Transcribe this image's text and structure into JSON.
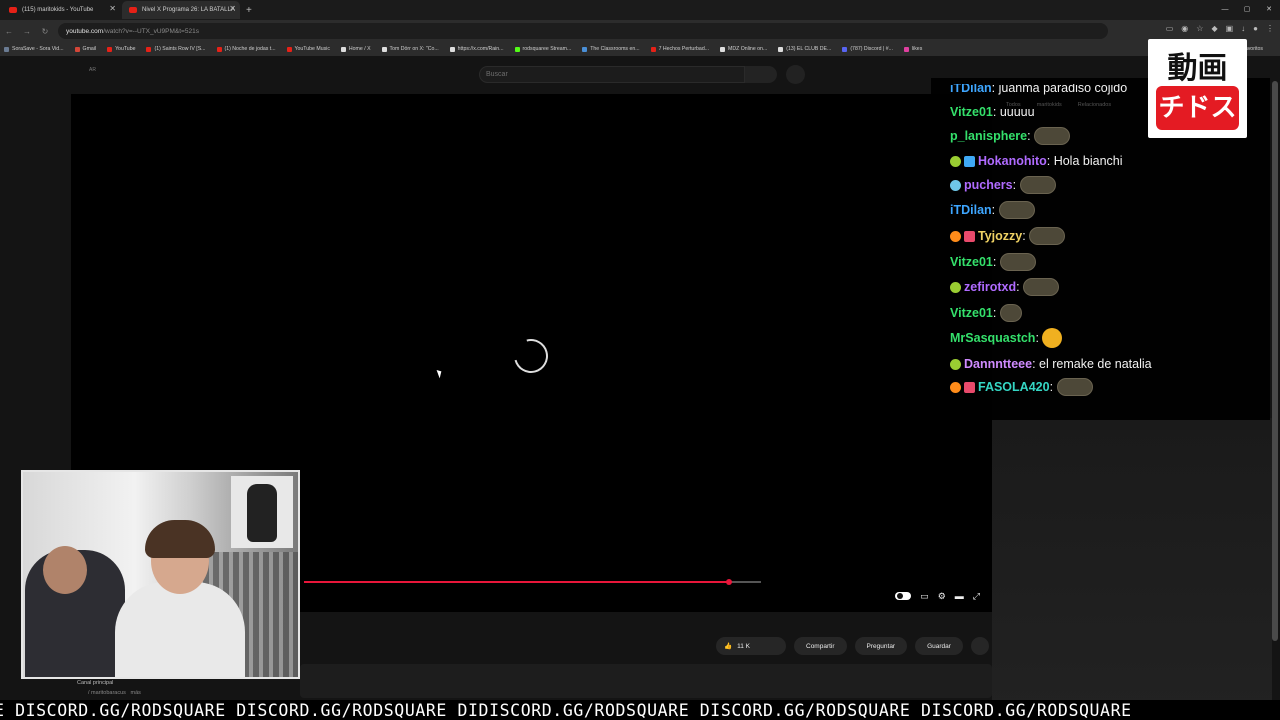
{
  "browser": {
    "tabs": [
      {
        "label": "(115) maritokids - YouTube",
        "active": false
      },
      {
        "label": "Nivel X Programa 26: LA BATALLA",
        "active": true
      }
    ],
    "url_host": "youtube.com",
    "url_rest": "/watch?v=--UTX_vU9PM&t=521s",
    "bookmarks": [
      "SoraSave - Sora Vid...",
      "Gmail",
      "YouTube",
      "(1) Saints Row IV [S...",
      "(1) Noche de jodas t...",
      "YouTube Music",
      "Home / X",
      "Tom Dörr on X: \"Co...",
      "https://x.com/Rain...",
      "rodsquaree Stream...",
      "The Classrooms en...",
      "7 Hechos Perturbad...",
      "MDZ Online on...",
      "(13) EL CLUB DE...",
      "(787) Discord | #...",
      "likes"
    ],
    "bookmarks_right": "favoritos"
  },
  "youtube": {
    "region": "AR",
    "search_placeholder": "Buscar",
    "like_count": "11 K",
    "share_label": "Compartir",
    "ask_label": "Preguntar",
    "save_label": "Guardar",
    "channel_label": "Canal principal",
    "channel_handle": "/ maritobaracus",
    "more_label": "más",
    "faded_tabs": [
      "Todos",
      "maritokids",
      "Relacionados"
    ],
    "progress_played_fraction": 0.93,
    "progress_buffer_end_fraction": 1.0
  },
  "chat": {
    "messages": [
      {
        "user": "iTDilan",
        "color": "#3ea6ff",
        "text": "juanma paradiso cojido",
        "emote": ""
      },
      {
        "user": "Vitze01",
        "color": "#34e06b",
        "text": "uuuuu",
        "emote": ""
      },
      {
        "user": "p_lanisphere",
        "color": "#34e06b",
        "text": "",
        "emote": "emote"
      },
      {
        "user": "Hokanohito",
        "color": "#b06bff",
        "text": "Hola bianchi",
        "emote": ""
      },
      {
        "user": "puchers",
        "color": "#b06bff",
        "text": "",
        "emote": "emote"
      },
      {
        "user": "iTDilan",
        "color": "#3ea6ff",
        "text": "",
        "emote": "emote"
      },
      {
        "user": "Tyjozzy",
        "color": "#f0d264",
        "text": "",
        "emote": "emote"
      },
      {
        "user": "Vitze01",
        "color": "#34e06b",
        "text": "",
        "emote": "emote"
      },
      {
        "user": "zefirotxd",
        "color": "#b06bff",
        "text": "",
        "emote": "emote"
      },
      {
        "user": "Vitze01",
        "color": "#34e06b",
        "text": "",
        "emote": "emote-small"
      },
      {
        "user": "MrSasquastch",
        "color": "#34e06b",
        "text": "",
        "emote": "face"
      },
      {
        "user": "Dannntteee",
        "color": "#cf8bff",
        "text": "el remake de natalia",
        "emote": ""
      },
      {
        "user": "FASOLA420",
        "color": "#35d6c4",
        "text": "",
        "emote": "emote"
      }
    ]
  },
  "overlay": {
    "logo_top": "動画",
    "logo_bottom": "チドス",
    "ticker_text": "E DISCORD.GG/RODSQUARE DISCORD.GG/RODSQUARE DIDISCORD.GG/RODSQUARE DISCORD.GG/RODSQUARE DISCORD.GG/RODSQUARE"
  }
}
